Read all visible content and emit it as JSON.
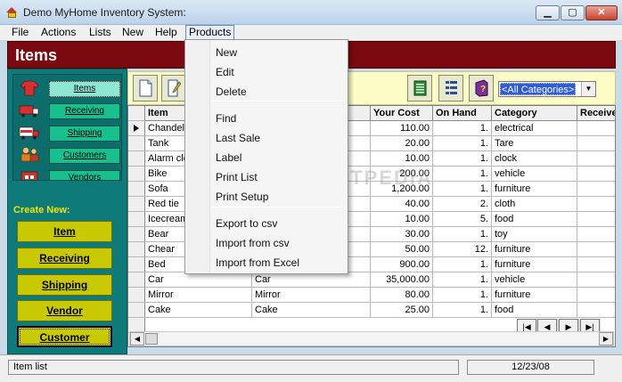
{
  "window": {
    "title": "Demo MyHome Inventory System:"
  },
  "menubar": [
    "File",
    "Actions",
    "Lists",
    "New",
    "Help",
    "Products"
  ],
  "header": {
    "title": "Items"
  },
  "nav": [
    "Items",
    "Receiving",
    "Shipping",
    "Customers",
    "Vendors"
  ],
  "create": {
    "label": "Create New:",
    "buttons": [
      "Item",
      "Receiving",
      "Shipping",
      "Vendor",
      "Customer"
    ]
  },
  "toolbar": {
    "category": "<All Categories>"
  },
  "grid": {
    "columns": [
      "Item",
      "",
      "Your Cost",
      "On Hand",
      "Category",
      "Receive"
    ],
    "rows": [
      [
        "Chandeli",
        "",
        "110.00",
        "1.",
        "electrical"
      ],
      [
        "Tank",
        "",
        "20.00",
        "1.",
        "Tare"
      ],
      [
        "Alarm clo",
        "",
        "10.00",
        "1.",
        "clock"
      ],
      [
        "Bike",
        "",
        "200.00",
        "1.",
        "vehicle"
      ],
      [
        "Sofa",
        "",
        "1,200.00",
        "1.",
        "furniture"
      ],
      [
        "Red tie",
        "",
        "40.00",
        "2.",
        "cloth"
      ],
      [
        "Icecream",
        "",
        "10.00",
        "5.",
        "food"
      ],
      [
        "Bear",
        "",
        "30.00",
        "1.",
        "toy"
      ],
      [
        "Chear",
        "",
        "50.00",
        "12.",
        "furniture"
      ],
      [
        "Bed",
        "",
        "900.00",
        "1.",
        "furniture"
      ],
      [
        "Car",
        "Car",
        "35,000.00",
        "1.",
        "vehicle"
      ],
      [
        "Mirror",
        "Mirror",
        "80.00",
        "1.",
        "furniture"
      ],
      [
        "Cake",
        "Cake",
        "25.00",
        "1.",
        "food"
      ]
    ]
  },
  "watermark": "SOFTPEDIA",
  "status": {
    "left": "Item list",
    "right": "12/23/08"
  },
  "dropdown": {
    "groups": [
      [
        "New",
        "Edit",
        "Delete"
      ],
      [
        "Find",
        "Last Sale",
        "Label",
        "Print List",
        "Print Setup"
      ],
      [
        "Export to csv",
        "Import from csv",
        "Import from Excel"
      ]
    ]
  },
  "colors": {
    "header": "#7a0a0f",
    "panel": "#0f7a7a",
    "navbtn": "#18c08f",
    "createbtn": "#c8c900",
    "toolbar": "#fdfdc8"
  }
}
